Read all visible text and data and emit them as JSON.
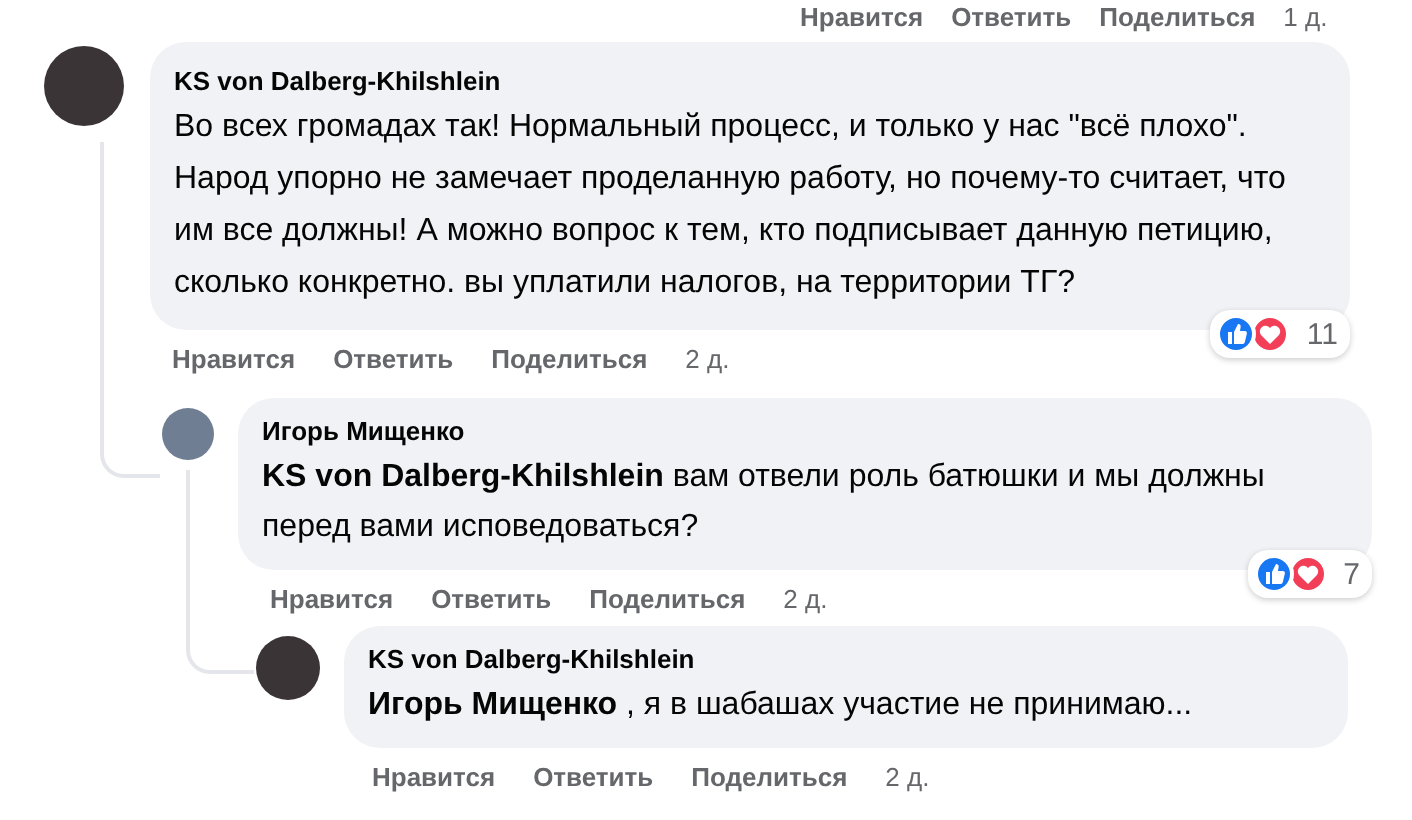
{
  "top_actions": {
    "actions": [
      "Нравится",
      "Ответить",
      "Поделиться"
    ],
    "time": "1 д."
  },
  "comments": [
    {
      "author": "KS von Dalberg-Khilshlein",
      "text": "Во всех громадах так! Нормальный процесс, и только у нас \"всё плохо\". Народ упорно не замечает проделанную работу, но почему-то считает, что им все должны! А можно вопрос к тем, кто подписывает данную петицию, сколько конкретно. вы уплатили налогов, на территории ТГ?",
      "actions": [
        "Нравится",
        "Ответить",
        "Поделиться"
      ],
      "time": "2 д.",
      "reaction_count": "11",
      "children": [
        {
          "author": "Игорь Мищенко",
          "text": "**KS von Dalberg-Khilshlein** вам отвели роль батюшки и мы должны перед вами исповедоваться?",
          "actions": [
            "Нравится",
            "Ответить",
            "Поделиться"
          ],
          "time": "2 д.",
          "reaction_count": "7",
          "children": [
            {
              "author": "KS von Dalberg-Khilshlein",
              "text": "**Игорь Мищенко** , я в шабашах участие не принимаю...",
              "actions": [
                "Нравится",
                "Ответить",
                "Поделиться"
              ],
              "time": "2 д."
            }
          ]
        }
      ]
    }
  ]
}
